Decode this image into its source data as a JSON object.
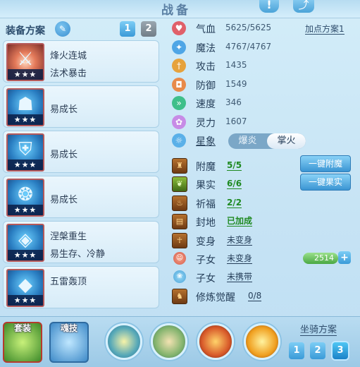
{
  "window": {
    "title": "战备",
    "help_icon": "exclamation-icon",
    "share_icon": "share-icon"
  },
  "equip_plan": {
    "label": "装备方案",
    "edit_icon": "pencil-icon",
    "tabs": [
      "1",
      "2"
    ],
    "active_tab": "1"
  },
  "equipment": [
    {
      "name": "烽火连城",
      "trait": "法术暴击",
      "stars": "★★★",
      "icon": "fire-sword-icon"
    },
    {
      "name": "",
      "trait": "易成长",
      "stars": "★★★",
      "icon": "blue-helmet-icon"
    },
    {
      "name": "",
      "trait": "易成长",
      "stars": "★★★",
      "icon": "blue-armor-icon"
    },
    {
      "name": "",
      "trait": "易成长",
      "stars": "★★★",
      "icon": "blue-necklace-icon"
    },
    {
      "name": "涅槃重生",
      "trait": "易生存、冷静",
      "stars": "★★★",
      "icon": "blue-belt-icon"
    },
    {
      "name": "五雷轰顶",
      "trait": "",
      "stars": "★★★",
      "icon": "blue-boots-icon"
    }
  ],
  "stats": [
    {
      "label": "气血",
      "value": "5625/5625",
      "icon": "heart-icon",
      "color": "#e0606a"
    },
    {
      "label": "魔法",
      "value": "4767/4767",
      "icon": "mana-star-icon",
      "color": "#4fa6e6"
    },
    {
      "label": "攻击",
      "value": "1435",
      "icon": "attack-icon",
      "color": "#e6a23c"
    },
    {
      "label": "防御",
      "value": "1549",
      "icon": "defense-icon",
      "color": "#e88a4a"
    },
    {
      "label": "速度",
      "value": "346",
      "icon": "speed-icon",
      "color": "#3fbf8a"
    },
    {
      "label": "灵力",
      "value": "1607",
      "icon": "spirit-icon",
      "color": "#c78be6"
    }
  ],
  "add_point_plan": "加点方案1",
  "element": {
    "label": "星象",
    "icon": "star-sign-icon",
    "options": [
      "爆炎",
      "掌火"
    ],
    "selected": "掌火"
  },
  "enhancements": [
    {
      "label": "附魔",
      "value": "5/5",
      "icon": "enchant-icon",
      "value_style": "green",
      "action": "一键附魔"
    },
    {
      "label": "果实",
      "value": "6/6",
      "icon": "fruit-icon",
      "value_style": "green",
      "action": "一键果实"
    },
    {
      "label": "祈福",
      "value": "2/2",
      "icon": "bless-icon",
      "value_style": "green",
      "action": ""
    },
    {
      "label": "封地",
      "value": "已加成",
      "icon": "territory-icon",
      "value_style": "green",
      "action": ""
    },
    {
      "label": "变身",
      "value": "未变身",
      "icon": "transform-icon",
      "value_style": "plain",
      "action": ""
    },
    {
      "label": "子女",
      "value": "未变身",
      "icon": "child-icon",
      "value_style": "plain",
      "action": ""
    },
    {
      "label": "子女",
      "value": "未携带",
      "icon": "paw-icon",
      "value_style": "plain",
      "action": ""
    },
    {
      "label": "修炼觉醒",
      "value": "0/8",
      "icon": "cultivation-icon",
      "value_style": "plain",
      "action": ""
    }
  ],
  "child_power": "2514",
  "bottom": {
    "set_label": "套装",
    "soul_label": "魂技",
    "mount_label": "坐骑方案",
    "mount_tabs": [
      "1",
      "2",
      "3"
    ],
    "active_mount": "3",
    "orb_icons": [
      "wind-orb-icon",
      "nature-orb-icon",
      "fire-orb-icon",
      "flame-burst-orb-icon"
    ]
  }
}
